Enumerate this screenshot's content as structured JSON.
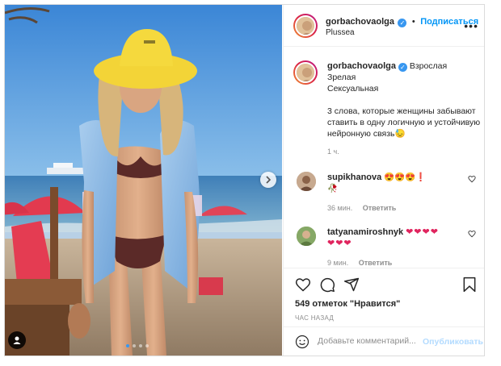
{
  "post": {
    "username": "gorbachovaolga",
    "verified_mark": "✓",
    "follow_label": "Подписаться",
    "separator": "•",
    "location": "Plussea",
    "more_label": "•••"
  },
  "caption": {
    "username": "gorbachovaolga",
    "lines": [
      "Взрослая",
      "Зрелая",
      "Сексуальная"
    ],
    "body": "3 слова, которые женщины забывают ставить в одну логичную и устойчивую нейронную связь",
    "emoji": "😓",
    "time": "1 ч."
  },
  "comments": [
    {
      "username": "supikhanova",
      "text": "😍😍😍❗",
      "extra": "🥀",
      "time": "36 мин.",
      "reply_label": "Ответить"
    },
    {
      "username": "tatyanamiroshnyk",
      "text": "❤❤❤❤",
      "extra": "❤❤❤",
      "time": "9 мин.",
      "reply_label": "Ответить"
    }
  ],
  "actions": {
    "likes": "549 отметок \"Нравится\"",
    "time_ago": "ЧАС НАЗАД"
  },
  "add_comment": {
    "placeholder": "Добавьте комментарий...",
    "publish_label": "Опубликовать"
  },
  "icons": {
    "like": "heart-icon",
    "comment": "comment-icon",
    "share": "share-icon",
    "save": "bookmark-icon",
    "emoji": "emoji-icon",
    "next": "chevron-right-icon",
    "user_tag": "user-tag-icon"
  },
  "colors": {
    "accent": "#0095f6",
    "verified": "#3897f0",
    "muted": "#8e8e8e",
    "heart": "#e0245e"
  }
}
